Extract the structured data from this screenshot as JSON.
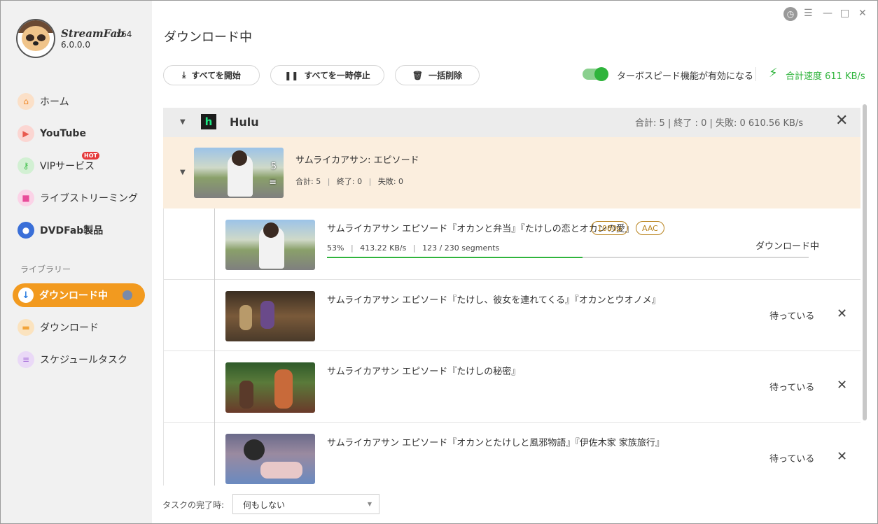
{
  "app": {
    "name": "StreamFab",
    "arch": "x64",
    "version": "6.0.0.0"
  },
  "sidebar": {
    "items": [
      {
        "label": "ホーム",
        "icon": "home-icon",
        "color": "#f5a45c"
      },
      {
        "label": "YouTube",
        "icon": "youtube-icon",
        "color": "#e85a4f"
      },
      {
        "label": "VIPサービス",
        "icon": "key-icon",
        "color": "#3fbf4a",
        "badge": "HOT"
      },
      {
        "label": "ライブストリーミング",
        "icon": "camera-icon",
        "color": "#e84c9a"
      },
      {
        "label": "DVDFab製品",
        "icon": "dvdfab-icon",
        "color": "#3a6fd8"
      }
    ],
    "library_label": "ライブラリー",
    "library": [
      {
        "label": "ダウンロード中",
        "icon": "download-icon",
        "active": true
      },
      {
        "label": "ダウンロード",
        "icon": "folder-icon",
        "color": "#f2a43a"
      },
      {
        "label": "スケジュールタスク",
        "icon": "schedule-icon",
        "color": "#a46bd8"
      }
    ]
  },
  "main": {
    "title": "ダウンロード中",
    "toolbar": {
      "start_all": "すべてを開始",
      "pause_all": "すべてを一時停止",
      "delete_all": "一括削除",
      "turbo_label": "ターボスピード機能が有効になる",
      "turbo_enabled": true,
      "speed_label": "合計速度 611 KB/s"
    },
    "group": {
      "name": "Hulu",
      "stats": "合計: 5 | 終了 : 0 | 失敗: 0    610.56 KB/s",
      "series": {
        "title": "サムライカアサン: エピソード",
        "count": "5",
        "total": "合計: 5",
        "done": "終了: 0",
        "failed": "失敗: 0"
      },
      "episodes": [
        {
          "title": "サムライカアサン エピソード『オカンと弁当』『たけしの恋とオカンの愛』",
          "tags": [
            "1080p",
            "AAC"
          ],
          "percent_text": "53%",
          "speed": "413.22 KB/s",
          "segments": "123 / 230 segments",
          "progress": 0.53,
          "status": "ダウンロード中"
        },
        {
          "title": "サムライカアサン エピソード『たけし、彼女を連れてくる』『オカンとウオノメ』",
          "status": "待っている"
        },
        {
          "title": "サムライカアサン エピソード『たけしの秘密』",
          "status": "待っている"
        },
        {
          "title": "サムライカアサン エピソード『オカンとたけしと風邪物語』『伊佐木家 家族旅行』",
          "status": "待っている"
        }
      ]
    },
    "footer": {
      "label": "タスクの完了時:",
      "select_value": "何もしない"
    }
  },
  "colors": {
    "accent": "#f29a1f",
    "green": "#2fb43c",
    "series_bg": "#fbeede"
  }
}
